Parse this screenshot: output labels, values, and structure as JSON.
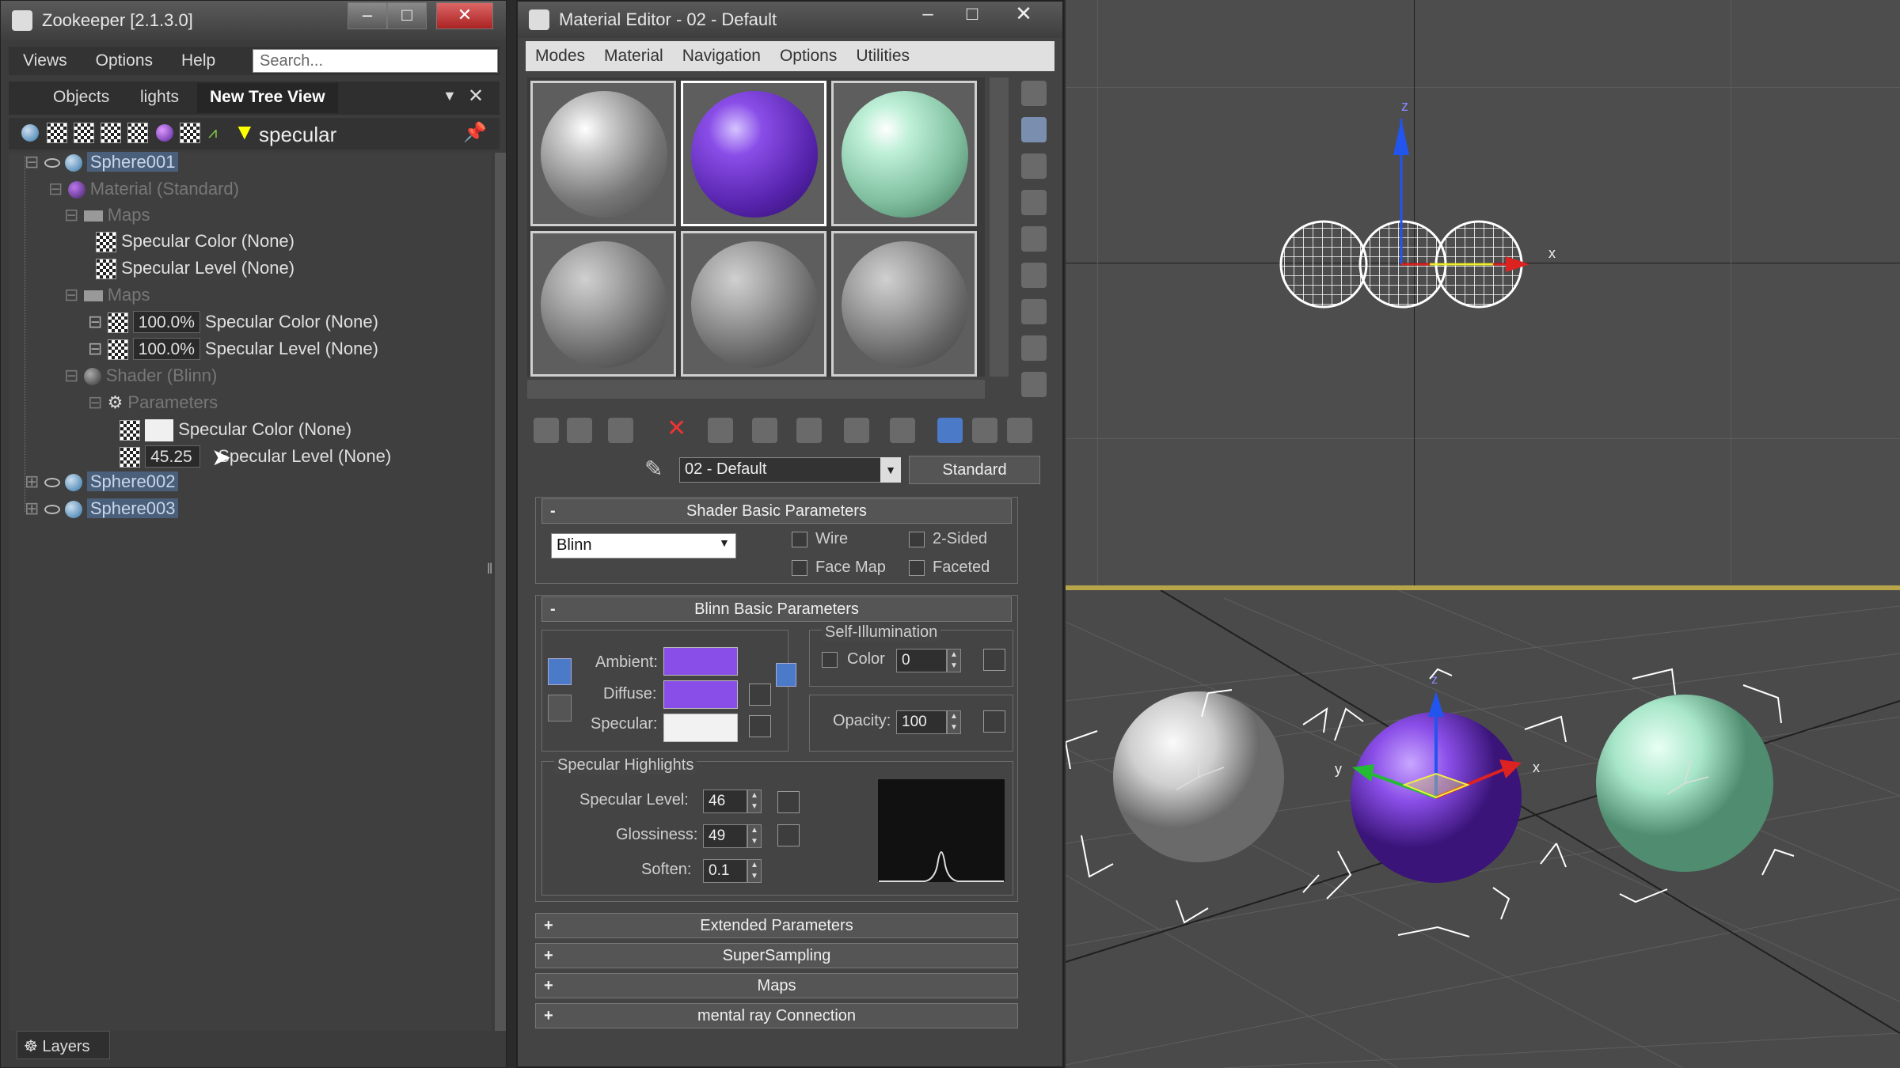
{
  "zookeeper": {
    "title": "Zookeeper [2.1.3.0]",
    "menu": [
      "Views",
      "Options",
      "Help"
    ],
    "search_placeholder": "Search...",
    "tabs": [
      "Objects",
      "lights",
      "New Tree View"
    ],
    "filter_text": "specular",
    "tree": {
      "sphere001": "Sphere001",
      "material": "Material (Standard)",
      "maps1": "Maps",
      "spec_color_1": "Specular Color (None)",
      "spec_level_1": "Specular Level (None)",
      "maps2": "Maps",
      "pct1": "100.0%",
      "spec_color_2": "Specular Color (None)",
      "pct2": "100.0%",
      "spec_level_2": "Specular Level (None)",
      "shader": "Shader (Blinn)",
      "parameters": "Parameters",
      "spec_color_3": "Specular Color (None)",
      "spec_level_value": "45.25",
      "spec_level_3": "Specular Level (None)",
      "sphere002": "Sphere002",
      "sphere003": "Sphere003"
    },
    "layers_label": "Layers"
  },
  "material_editor": {
    "title": "Material Editor - 02 - Default",
    "menu": [
      "Modes",
      "Material",
      "Navigation",
      "Options",
      "Utilities"
    ],
    "material_name": "02 - Default",
    "material_type": "Standard",
    "shader_basic": {
      "header": "Shader Basic Parameters",
      "shader": "Blinn",
      "wire": "Wire",
      "two_sided": "2-Sided",
      "face_map": "Face Map",
      "faceted": "Faceted"
    },
    "blinn_basic": {
      "header": "Blinn Basic Parameters",
      "self_illum_title": "Self-Illumination",
      "color_label": "Color",
      "color_value": "0",
      "ambient": "Ambient:",
      "diffuse": "Diffuse:",
      "specular": "Specular:",
      "opacity_label": "Opacity:",
      "opacity_value": "100",
      "ambient_color": "#8a4ee8",
      "diffuse_color": "#8a4ee8",
      "specular_color": "#f2f2f2"
    },
    "specular_highlights": {
      "title": "Specular Highlights",
      "level_label": "Specular Level:",
      "level_value": "46",
      "gloss_label": "Glossiness:",
      "gloss_value": "49",
      "soften_label": "Soften:",
      "soften_value": "0.1"
    },
    "rollouts": [
      "Extended Parameters",
      "SuperSampling",
      "Maps",
      "mental ray Connection"
    ],
    "sample_slots": [
      "#c8c8c8",
      "#7b46d6",
      "#9fe0c3",
      "#9a9a9a",
      "#9a9a9a",
      "#9a9a9a"
    ]
  },
  "viewport": {
    "axis_x": "x",
    "axis_y": "y",
    "axis_z": "z"
  }
}
